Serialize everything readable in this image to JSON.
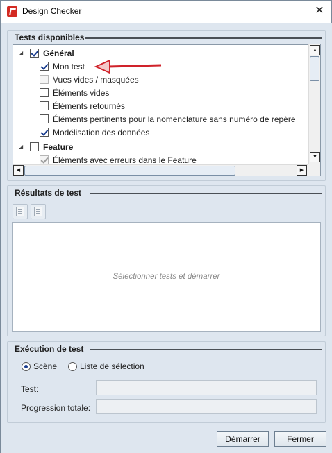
{
  "window": {
    "title": "Design Checker",
    "close_glyph": "✕"
  },
  "tests_group": {
    "title": "Tests disponibles",
    "tree": [
      {
        "label": "Général",
        "level": 0,
        "expanded": true,
        "checked": true,
        "bold": true,
        "disabled": false
      },
      {
        "label": "Mon test",
        "level": 1,
        "checked": true,
        "bold": false,
        "disabled": false
      },
      {
        "label": "Vues vides / masquées",
        "level": 1,
        "checked": false,
        "bold": false,
        "disabled": true
      },
      {
        "label": "Éléments vides",
        "level": 1,
        "checked": false,
        "bold": false,
        "disabled": false
      },
      {
        "label": "Éléments retournés",
        "level": 1,
        "checked": false,
        "bold": false,
        "disabled": false
      },
      {
        "label": "Éléments pertinents pour la nomenclature sans numéro de repère",
        "level": 1,
        "checked": false,
        "bold": false,
        "disabled": false
      },
      {
        "label": "Modélisation des données",
        "level": 1,
        "checked": true,
        "bold": false,
        "disabled": false
      },
      {
        "label": "Feature",
        "level": 0,
        "expanded": true,
        "checked": false,
        "bold": true,
        "disabled": false
      },
      {
        "label": "Éléments avec erreurs dans le Feature",
        "level": 1,
        "checked": true,
        "bold": false,
        "disabled": true
      }
    ],
    "annotation_color": "#d0222a"
  },
  "results_group": {
    "title": "Résultats de test",
    "placeholder": "Sélectionner tests et démarrer",
    "toolbar_icons": [
      "expand-results-icon",
      "collapse-results-icon"
    ]
  },
  "execution_group": {
    "title": "Exécution de test",
    "radio_scene": "Scène",
    "radio_selection": "Liste de sélection",
    "selected": "Scène",
    "test_label": "Test:",
    "progress_label": "Progression totale:",
    "test_value": "",
    "progress_value": ""
  },
  "buttons": {
    "start": "Démarrer",
    "close": "Fermer"
  }
}
